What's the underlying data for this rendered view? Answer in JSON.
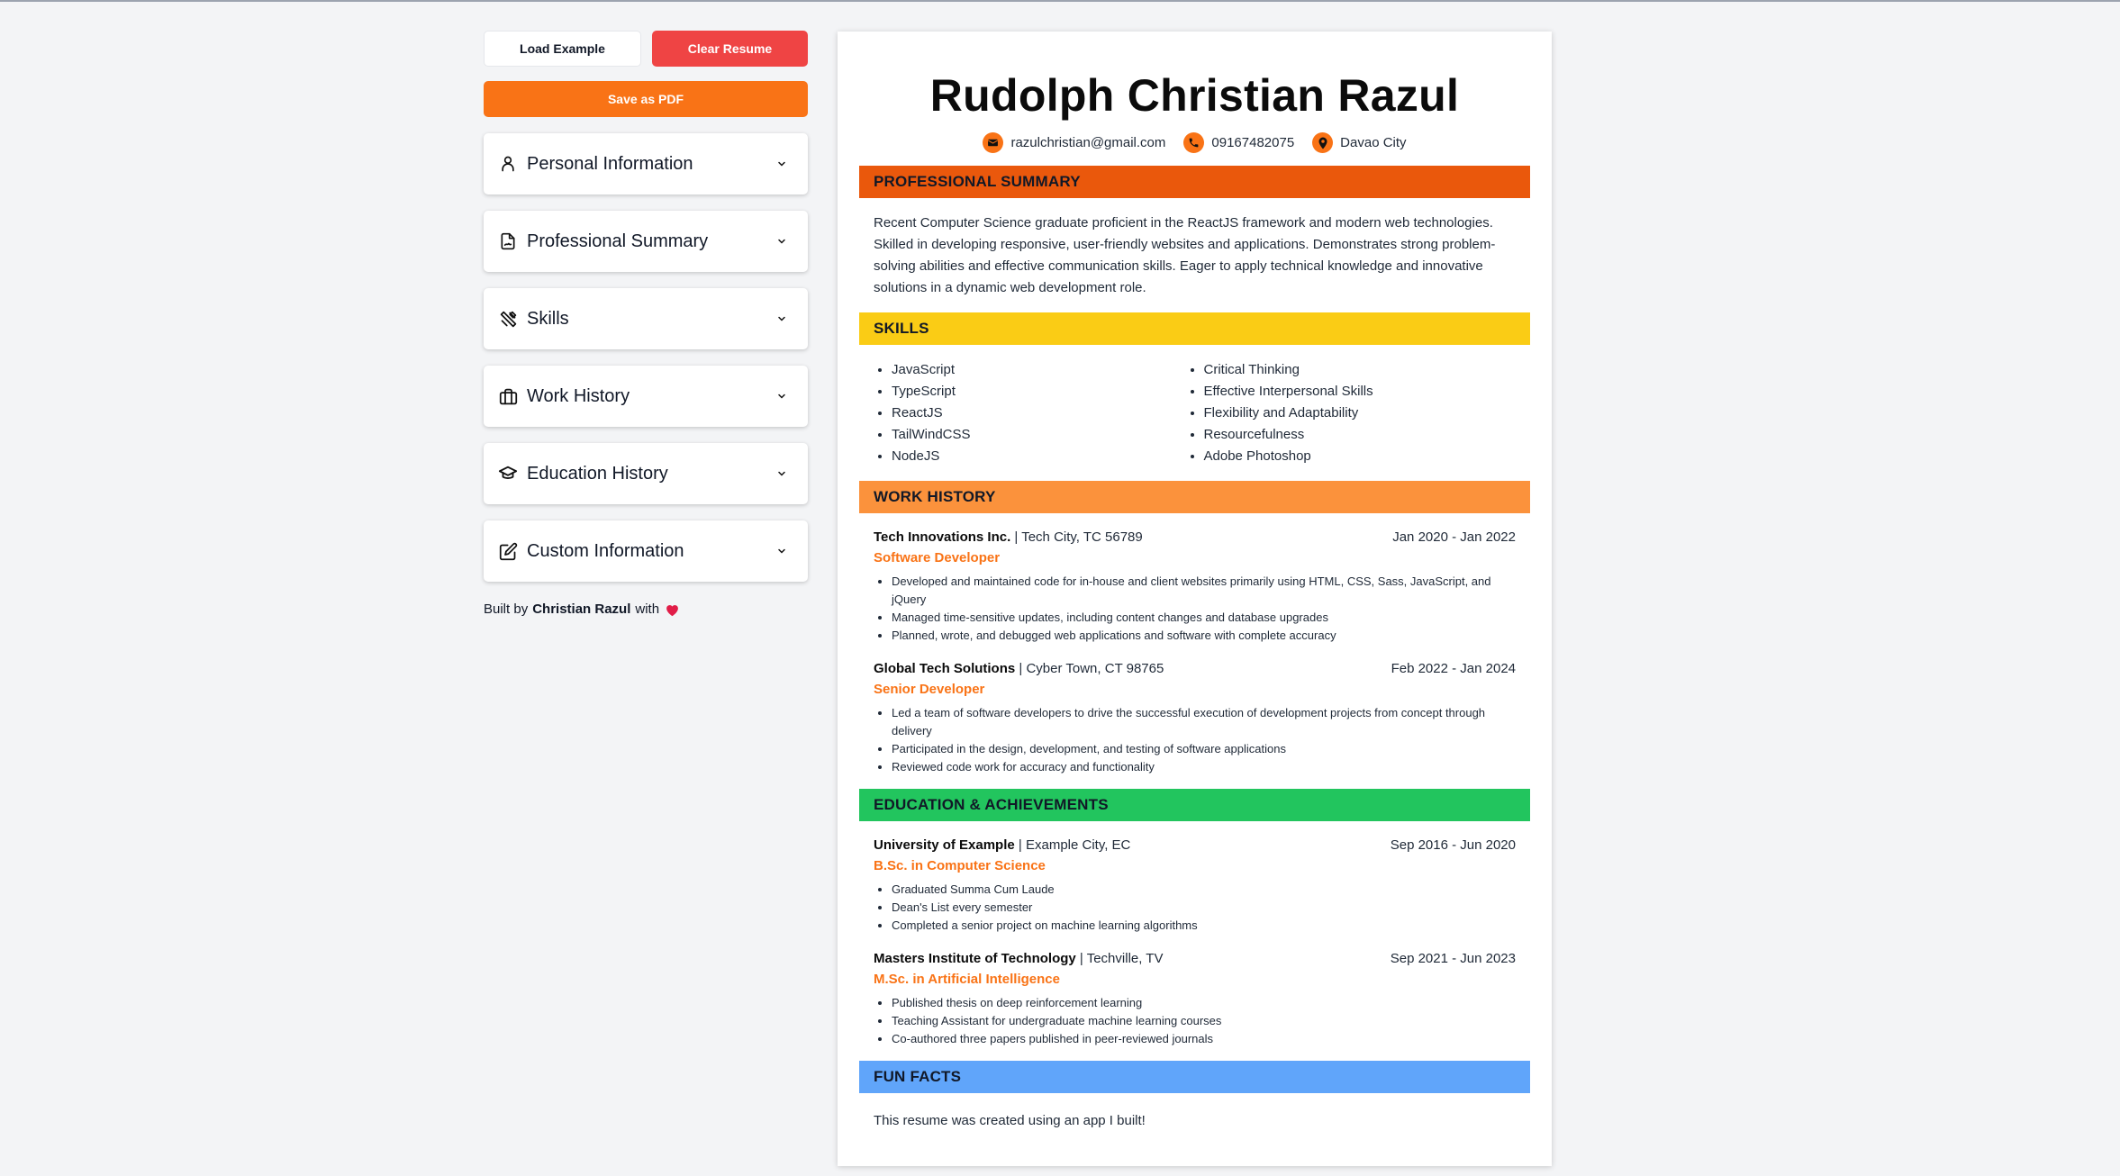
{
  "controls": {
    "load_example": "Load Example",
    "clear_resume": "Clear Resume",
    "save_pdf": "Save as PDF"
  },
  "sections": [
    {
      "label": "Personal Information",
      "icon": "user-icon"
    },
    {
      "label": "Professional Summary",
      "icon": "file-signature-icon"
    },
    {
      "label": "Skills",
      "icon": "tools-icon"
    },
    {
      "label": "Work History",
      "icon": "briefcase-icon"
    },
    {
      "label": "Education History",
      "icon": "graduation-cap-icon"
    },
    {
      "label": "Custom Information",
      "icon": "edit-icon"
    }
  ],
  "credit": {
    "prefix": "Built by",
    "author": "Christian Razul",
    "suffix": "with"
  },
  "resume": {
    "name": "Rudolph Christian Razul",
    "contact": {
      "email": "razulchristian@gmail.com",
      "phone": "09167482075",
      "location": "Davao City"
    },
    "summary_heading": "PROFESSIONAL SUMMARY",
    "summary_text": "Recent Computer Science graduate proficient in the ReactJS framework and modern web technologies. Skilled in developing responsive, user-friendly websites and applications. Demonstrates strong problem-solving abilities and effective communication skills. Eager to apply technical knowledge and innovative solutions in a dynamic web development role.",
    "skills_heading": "SKILLS",
    "skills_left": [
      "JavaScript",
      "TypeScript",
      "ReactJS",
      "TailWindCSS",
      "NodeJS"
    ],
    "skills_right": [
      "Critical Thinking",
      "Effective Interpersonal Skills",
      "Flexibility and Adaptability",
      "Resourcefulness",
      "Adobe Photoshop"
    ],
    "work_heading": "WORK HISTORY",
    "work": [
      {
        "company": "Tech Innovations Inc.",
        "location": "| Tech City, TC 56789",
        "dates": "Jan 2020 - Jan 2022",
        "role": "Software Developer",
        "bullets": [
          "Developed and maintained code for in-house and client websites primarily using HTML, CSS, Sass, JavaScript, and jQuery",
          "Managed time-sensitive updates, including content changes and database upgrades",
          "Planned, wrote, and debugged web applications and software with complete accuracy"
        ]
      },
      {
        "company": "Global Tech Solutions",
        "location": "| Cyber Town, CT 98765",
        "dates": "Feb 2022 - Jan 2024",
        "role": "Senior Developer",
        "bullets": [
          "Led a team of software developers to drive the successful execution of development projects from concept through delivery",
          "Participated in the design, development, and testing of software applications",
          "Reviewed code work for accuracy and functionality"
        ]
      }
    ],
    "education_heading": "EDUCATION & ACHIEVEMENTS",
    "education": [
      {
        "school": "University of Example",
        "location": "| Example City, EC",
        "dates": "Sep 2016 - Jun 2020",
        "degree": "B.Sc. in Computer Science",
        "bullets": [
          "Graduated Summa Cum Laude",
          "Dean's List every semester",
          "Completed a senior project on machine learning algorithms"
        ]
      },
      {
        "school": "Masters Institute of Technology",
        "location": "| Techville, TV",
        "dates": "Sep 2021 - Jun 2023",
        "degree": "M.Sc. in Artificial Intelligence",
        "bullets": [
          "Published thesis on deep reinforcement learning",
          "Teaching Assistant for undergraduate machine learning courses",
          "Co-authored three papers published in peer-reviewed journals"
        ]
      }
    ],
    "funfacts_heading": "FUN FACTS",
    "funfacts_text": "This resume was created using an app I built!"
  },
  "colors": {
    "summary": "#ea580c",
    "skills": "#facc15",
    "work": "#fb923c",
    "education": "#22c55e",
    "funfacts": "#60a5fa",
    "accent": "#f97316",
    "danger": "#ef4444"
  }
}
